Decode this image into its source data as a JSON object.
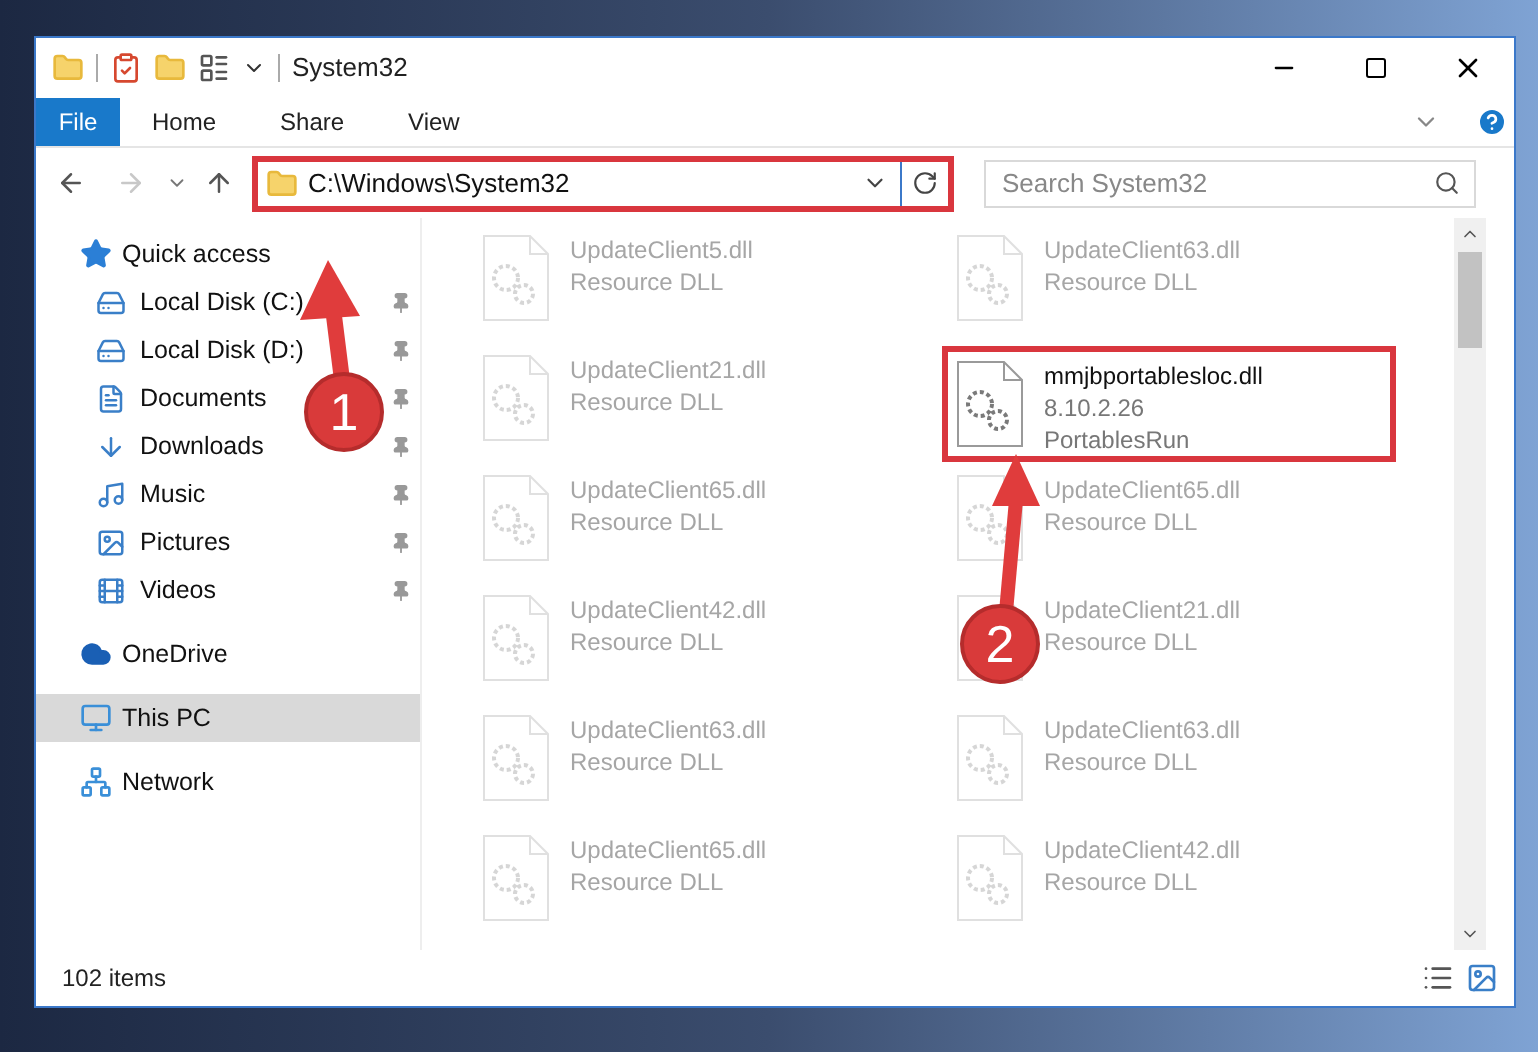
{
  "window": {
    "title": "System32"
  },
  "ribbon_tabs": [
    {
      "label": "File",
      "kind": "file"
    },
    {
      "label": "Home",
      "kind": "tab"
    },
    {
      "label": "Share",
      "kind": "tab"
    },
    {
      "label": "View",
      "kind": "tab"
    }
  ],
  "address_bar": {
    "path": "C:\\Windows\\System32",
    "highlighted": true
  },
  "search": {
    "placeholder": "Search System32"
  },
  "sidebar": {
    "items": [
      {
        "label": "Quick access",
        "selected": false,
        "children": [
          {
            "label": "Local Disk (C:)",
            "pinned": true
          },
          {
            "label": "Local Disk (D:)",
            "pinned": true
          },
          {
            "label": "Documents",
            "pinned": true
          },
          {
            "label": "Downloads",
            "pinned": true
          },
          {
            "label": "Music",
            "pinned": true
          },
          {
            "label": "Pictures",
            "pinned": true
          },
          {
            "label": "Videos",
            "pinned": true
          }
        ]
      },
      {
        "label": "OneDrive",
        "selected": false
      },
      {
        "label": "This PC",
        "selected": true
      },
      {
        "label": "Network",
        "selected": false
      }
    ]
  },
  "files": [
    {
      "name": "UpdateClient5.dll",
      "details": [
        "Resource DLL"
      ],
      "faded": true,
      "highlighted": false
    },
    {
      "name": "UpdateClient63.dll",
      "details": [
        "Resource DLL"
      ],
      "faded": true,
      "highlighted": false
    },
    {
      "name": "UpdateClient21.dll",
      "details": [
        "Resource DLL"
      ],
      "faded": true,
      "highlighted": false
    },
    {
      "name": "mmjbportablesloc.dll",
      "details": [
        "8.10.2.26",
        "PortablesRun"
      ],
      "faded": false,
      "highlighted": true
    },
    {
      "name": "UpdateClient65.dll",
      "details": [
        "Resource DLL"
      ],
      "faded": true,
      "highlighted": false
    },
    {
      "name": "UpdateClient65.dll",
      "details": [
        "Resource DLL"
      ],
      "faded": true,
      "highlighted": false
    },
    {
      "name": "UpdateClient42.dll",
      "details": [
        "Resource DLL"
      ],
      "faded": true,
      "highlighted": false
    },
    {
      "name": "UpdateClient21.dll",
      "details": [
        "Resource DLL"
      ],
      "faded": true,
      "highlighted": false
    },
    {
      "name": "UpdateClient63.dll",
      "details": [
        "Resource DLL"
      ],
      "faded": true,
      "highlighted": false
    },
    {
      "name": "UpdateClient63.dll",
      "details": [
        "Resource DLL"
      ],
      "faded": true,
      "highlighted": false
    },
    {
      "name": "UpdateClient65.dll",
      "details": [
        "Resource DLL"
      ],
      "faded": true,
      "highlighted": false
    },
    {
      "name": "UpdateClient42.dll",
      "details": [
        "Resource DLL"
      ],
      "faded": true,
      "highlighted": false
    }
  ],
  "status_bar": {
    "count": "102 items"
  },
  "annotations": [
    {
      "label": "1"
    },
    {
      "label": "2"
    }
  ]
}
